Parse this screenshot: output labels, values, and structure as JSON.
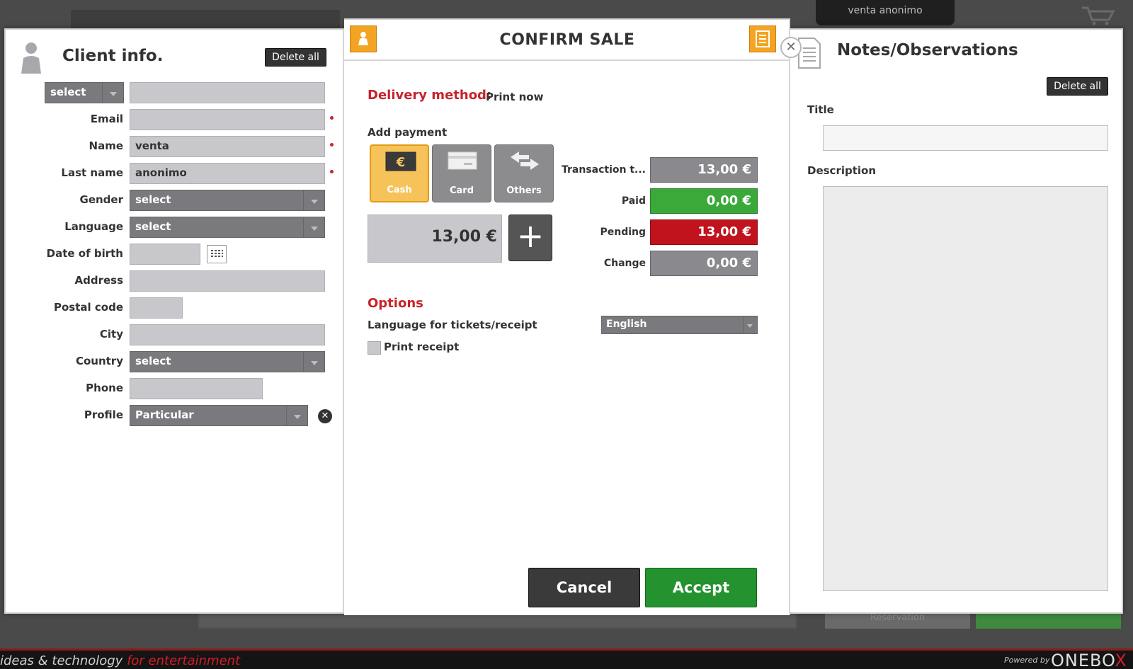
{
  "background": {
    "sale_tab": "venta anonimo",
    "reservation_label": "Reservation"
  },
  "footer": {
    "slogan_main": "ideas & technology ",
    "slogan_accent": "for entertainment",
    "powered_by": "Powered by",
    "brand_main": "ONEBO",
    "brand_x": "X"
  },
  "client": {
    "title": "Client info.",
    "delete_all": "Delete all",
    "title_select": "select",
    "fields": {
      "email": {
        "label": "Email",
        "value": ""
      },
      "name": {
        "label": "Name",
        "value": "venta"
      },
      "last_name": {
        "label": "Last name",
        "value": "anonimo"
      },
      "gender": {
        "label": "Gender",
        "value": "select"
      },
      "language": {
        "label": "Language",
        "value": "select"
      },
      "birth": {
        "label": "Date of birth",
        "value": ""
      },
      "address": {
        "label": "Address",
        "value": ""
      },
      "postal": {
        "label": "Postal code",
        "value": ""
      },
      "city": {
        "label": "City",
        "value": ""
      },
      "country": {
        "label": "Country",
        "value": "select"
      },
      "phone": {
        "label": "Phone",
        "value": ""
      },
      "profile": {
        "label": "Profile",
        "value": "Particular"
      }
    }
  },
  "confirm": {
    "title": "CONFIRM SALE",
    "delivery_label": "Delivery method:",
    "delivery_value": "Print now",
    "add_payment": "Add payment",
    "payment_methods": {
      "cash": "Cash",
      "card": "Card",
      "others": "Others"
    },
    "amount": "13,00 €",
    "totals": {
      "transaction": {
        "label": "Transaction t...",
        "value": "13,00 €"
      },
      "paid": {
        "label": "Paid",
        "value": "0,00 €"
      },
      "pending": {
        "label": "Pending",
        "value": "13,00 €"
      },
      "change": {
        "label": "Change",
        "value": "0,00 €"
      }
    },
    "options_label": "Options",
    "ticket_language_label": "Language for tickets/receipt",
    "ticket_language_value": "English",
    "print_receipt_label": "Print receipt",
    "print_receipt_checked": false,
    "cancel": "Cancel",
    "accept": "Accept"
  },
  "notes": {
    "title": "Notes/Observations",
    "delete_all": "Delete all",
    "title_label": "Title",
    "title_value": "",
    "description_label": "Description",
    "description_value": ""
  },
  "colors": {
    "accent_red": "#c8232c",
    "accent_orange": "#f3a422",
    "paid_green": "#3aa93a",
    "pending_red": "#c0131e",
    "neutral_gray": "#8a8a8e",
    "accept_green": "#23922f"
  }
}
